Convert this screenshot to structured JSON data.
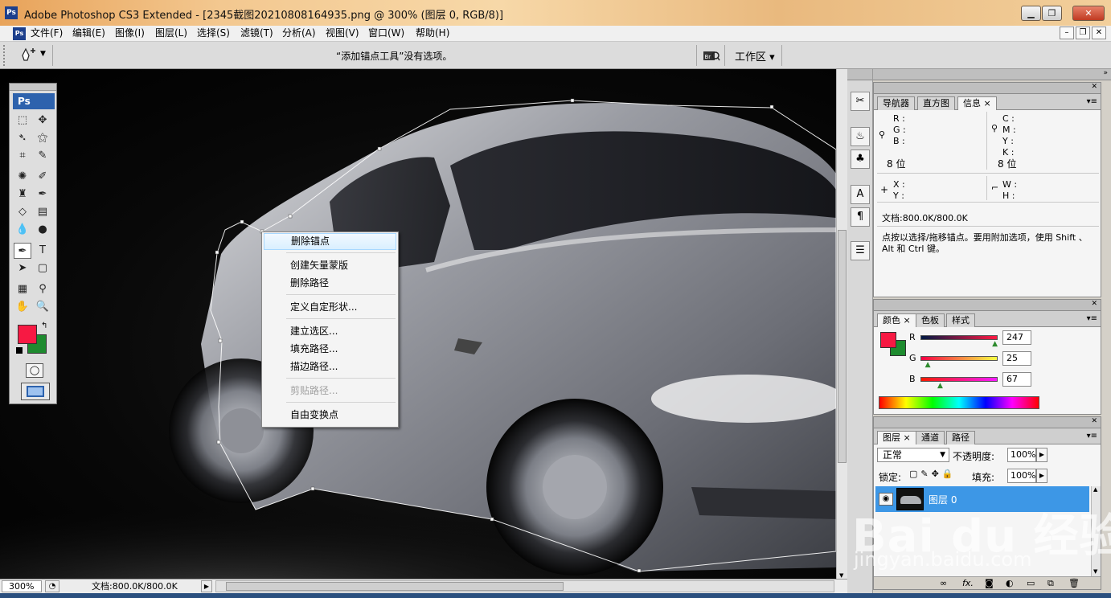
{
  "window": {
    "app_badge": "Ps",
    "title": "Adobe Photoshop CS3 Extended - [2345截图20210808164935.png @ 300% (图层 0, RGB/8)]",
    "controls": [
      "▁",
      "❐",
      "✕"
    ]
  },
  "menubar": {
    "items": [
      "文件(F)",
      "编辑(E)",
      "图像(I)",
      "图层(L)",
      "选择(S)",
      "滤镜(T)",
      "分析(A)",
      "视图(V)",
      "窗口(W)",
      "帮助(H)"
    ],
    "doc_controls": [
      "–",
      "❐",
      "✕"
    ]
  },
  "options": {
    "hint": "“添加锚点工具”没有选项。",
    "workspace": "工作区 ▾",
    "tool_icon": "pen-plus-icon",
    "bridge_icon": "bridge-icon"
  },
  "toolbox": {
    "badge": "Ps",
    "fg_color": "#F71943",
    "bg_color": "#1E8B2F"
  },
  "context_menu": {
    "items": [
      {
        "label": "删除锚点",
        "state": "highlight"
      },
      {
        "label": "创建矢量蒙版",
        "state": "normal"
      },
      {
        "label": "删除路径",
        "state": "normal"
      },
      {
        "label": "定义自定形状...",
        "state": "normal"
      },
      {
        "label": "建立选区...",
        "state": "normal"
      },
      {
        "label": "填充路径...",
        "state": "normal"
      },
      {
        "label": "描边路径...",
        "state": "normal"
      },
      {
        "label": "剪贴路径...",
        "state": "disabled"
      },
      {
        "label": "自由变换点",
        "state": "normal"
      }
    ]
  },
  "info_panel": {
    "tabs": [
      "导航器",
      "直方图",
      "信息"
    ],
    "active_tab": "信息",
    "rgb_labels": [
      "R :",
      "G :",
      "B :"
    ],
    "cmyk_labels": [
      "C :",
      "M :",
      "Y :",
      "K :"
    ],
    "bit_left": "8 位",
    "bit_right": "8 位",
    "xy_labels": [
      "X :",
      "Y :"
    ],
    "wh_labels": [
      "W :",
      "H :"
    ],
    "doc_size": "文档:800.0K/800.0K",
    "tip": "点按以选择/拖移锚点。要用附加选项，使用 Shift 、Alt 和 Ctrl 键。"
  },
  "color_panel": {
    "tabs": [
      "颜色",
      "色板",
      "样式"
    ],
    "active_tab": "颜色",
    "channels": [
      {
        "label": "R",
        "value": "247",
        "fraction": 0.97
      },
      {
        "label": "G",
        "value": "25",
        "fraction": 0.1
      },
      {
        "label": "B",
        "value": "67",
        "fraction": 0.26
      }
    ],
    "fg": "#F71943",
    "bg": "#1E8B2F"
  },
  "layers_panel": {
    "tabs": [
      "图层",
      "通道",
      "路径"
    ],
    "active_tab": "图层",
    "blend_mode": "正常",
    "opacity_label": "不透明度:",
    "opacity": "100%",
    "lock_label": "锁定:",
    "fill_label": "填充:",
    "fill": "100%",
    "layer_name": "图层 0",
    "bottom_icons": [
      "link-icon",
      "fx-icon",
      "mask-icon",
      "adjustment-icon",
      "group-icon",
      "new-layer-icon",
      "trash-icon"
    ],
    "fx_label": "fx."
  },
  "status": {
    "zoom": "300%",
    "doc_size": "文档:800.0K/800.0K"
  },
  "watermark": {
    "brand": "Bai du 经验",
    "url": "jingyan.baidu.com"
  }
}
